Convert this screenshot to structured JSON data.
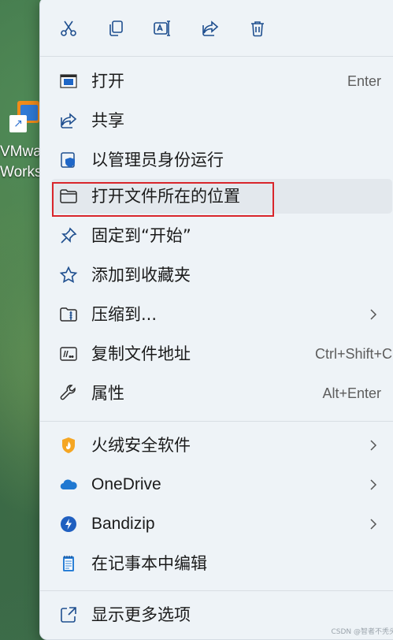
{
  "desktop": {
    "shortcut_icon": "vmware-workstation-icon",
    "shortcut_label": "VMware\nWorkst"
  },
  "toolbar": {
    "cut": "cut-icon",
    "copy": "copy-icon",
    "rename": "rename-icon",
    "share": "share-icon",
    "delete": "delete-icon"
  },
  "menu": {
    "items": [
      {
        "label": "打开",
        "shortcut": "Enter",
        "icon": "app-window-icon"
      },
      {
        "label": "共享",
        "icon": "share-icon"
      },
      {
        "label": "以管理员身份运行",
        "icon": "shield-icon"
      },
      {
        "label": "打开文件所在的位置",
        "icon": "folder-icon"
      },
      {
        "label": "固定到“开始”",
        "icon": "pin-icon"
      },
      {
        "label": "添加到收藏夹",
        "icon": "star-icon"
      },
      {
        "label": "压缩到...",
        "icon": "zip-folder-icon"
      },
      {
        "label": "复制文件地址",
        "shortcut": "Ctrl+Shift+C",
        "icon": "copy-path-icon"
      },
      {
        "label": "属性",
        "shortcut": "Alt+Enter",
        "icon": "wrench-icon"
      }
    ],
    "items2": [
      {
        "label": "火绒安全软件",
        "icon": "huorong-icon"
      },
      {
        "label": "OneDrive",
        "icon": "onedrive-icon"
      },
      {
        "label": "Bandizip",
        "icon": "bandizip-icon"
      },
      {
        "label": "在记事本中编辑",
        "icon": "notepad-icon"
      }
    ],
    "more": {
      "label": "显示更多选项",
      "icon": "show-more-icon"
    }
  },
  "colors": {
    "menu_bg": "#eef3f7",
    "hover_bg": "#e3e8ed",
    "highlight_border": "#d9252b",
    "accent": "#1f67c7"
  },
  "watermark": "CSDN @智者不秃头"
}
